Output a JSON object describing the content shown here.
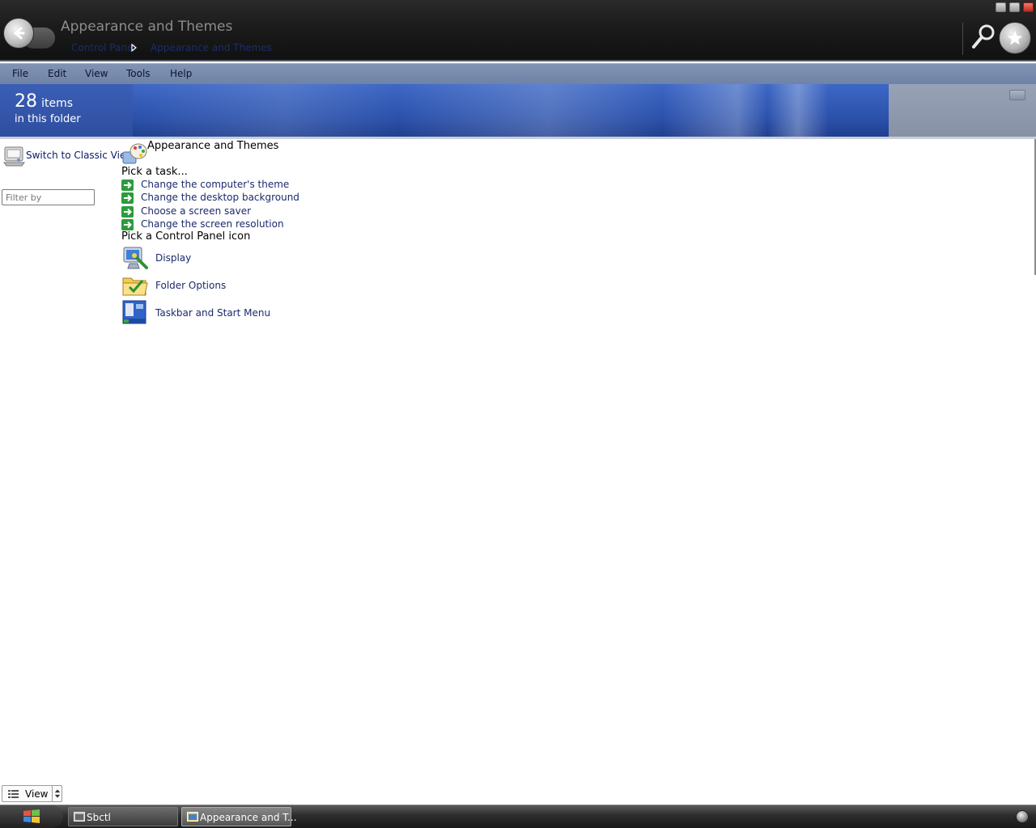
{
  "window": {
    "title": "Appearance and Themes",
    "breadcrumbs": [
      "Control Panel",
      "Appearance and Themes"
    ]
  },
  "menu": [
    "File",
    "Edit",
    "View",
    "Tools",
    "Help"
  ],
  "banner": {
    "count": "28",
    "count_unit": "items",
    "subtitle": "in this folder"
  },
  "left_pane": {
    "classic_view_label": "Switch to Classic View",
    "filter_placeholder": "Filter by"
  },
  "category": {
    "title": "Appearance and Themes",
    "task_heading": "Pick a task...",
    "tasks": [
      "Change the computer's theme",
      "Change the desktop background",
      "Choose a screen saver",
      "Change the screen resolution"
    ],
    "icon_heading": "Pick a Control Panel icon",
    "icons": [
      {
        "label": "Display",
        "icon": "display-icon"
      },
      {
        "label": "Folder Options",
        "icon": "folder-options-icon"
      },
      {
        "label": "Taskbar and Start Menu",
        "icon": "taskbar-icon"
      }
    ]
  },
  "status": {
    "view_label": "View"
  },
  "taskbar": {
    "items": [
      {
        "label": "Sbctl",
        "active": false
      },
      {
        "label": "Appearance and T...",
        "active": true
      }
    ]
  },
  "colors": {
    "link": "#1b2a6b",
    "menubar": "#7789ac",
    "banner_blue": "#2f56b0"
  }
}
